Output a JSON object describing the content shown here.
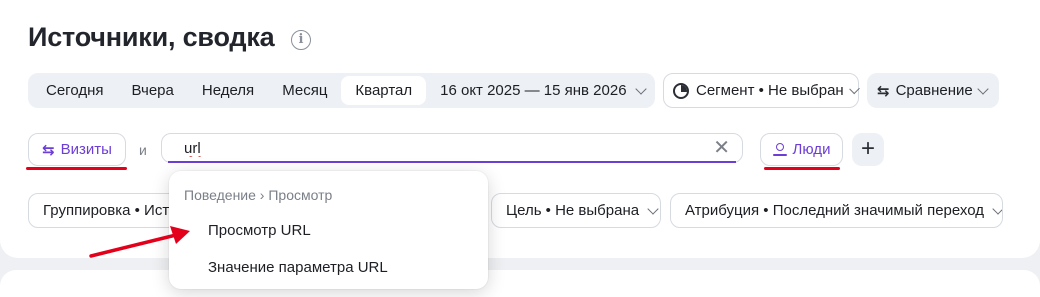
{
  "page": {
    "title": "Источники, сводка"
  },
  "period_tabs": [
    "Сегодня",
    "Вчера",
    "Неделя",
    "Месяц",
    "Квартал"
  ],
  "active_period": "Квартал",
  "date_range": "16 окт 2025 — 15 янв 2026",
  "segment_label": "Сегмент • Не выбран",
  "compare_label": "Сравнение",
  "filter": {
    "visits_label": "Визиты",
    "and_label": "и",
    "search_value": "url",
    "people_label": "Люди"
  },
  "chips": {
    "grouping": "Группировка • Исто",
    "goal": "Цель • Не выбрана",
    "attribution": "Атрибуция • Последний значимый переход"
  },
  "dropdown": {
    "breadcrumb": "Поведение › Просмотр",
    "items": [
      "Просмотр URL",
      "Значение параметра URL"
    ]
  },
  "colors": {
    "accent": "#6c3ed6",
    "annotation": "#e3001b"
  }
}
